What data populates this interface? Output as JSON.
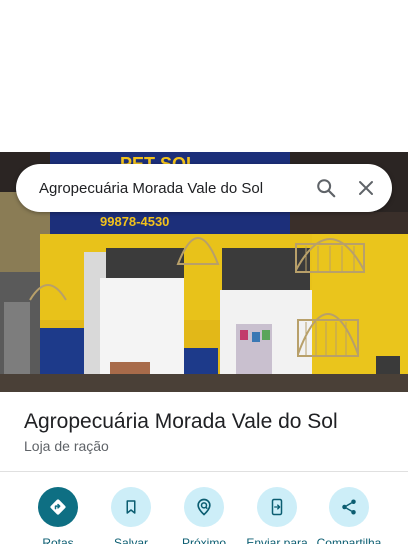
{
  "search": {
    "query": "Agropecuária Morada Vale do Sol"
  },
  "place": {
    "title": "Agropecuária Morada Vale do Sol",
    "category": "Loja de ração"
  },
  "photo": {
    "sign_text": "PET SOL",
    "phone_fragment": "99878-4530"
  },
  "actions": [
    {
      "label": "Rotas",
      "icon": "directions-icon"
    },
    {
      "label": "Salvar",
      "icon": "bookmark-icon"
    },
    {
      "label": "Próximo",
      "icon": "nearby-icon"
    },
    {
      "label": "Enviar para",
      "icon": "send-to-phone-icon"
    },
    {
      "label": "Compartilha",
      "icon": "share-icon"
    }
  ],
  "colors": {
    "primary": "#0e6f83",
    "action_bg": "#cdeef8",
    "action_label": "#0b5d71",
    "storefront_yellow": "#e8c21a",
    "storefront_blue": "#1d3a8a"
  }
}
